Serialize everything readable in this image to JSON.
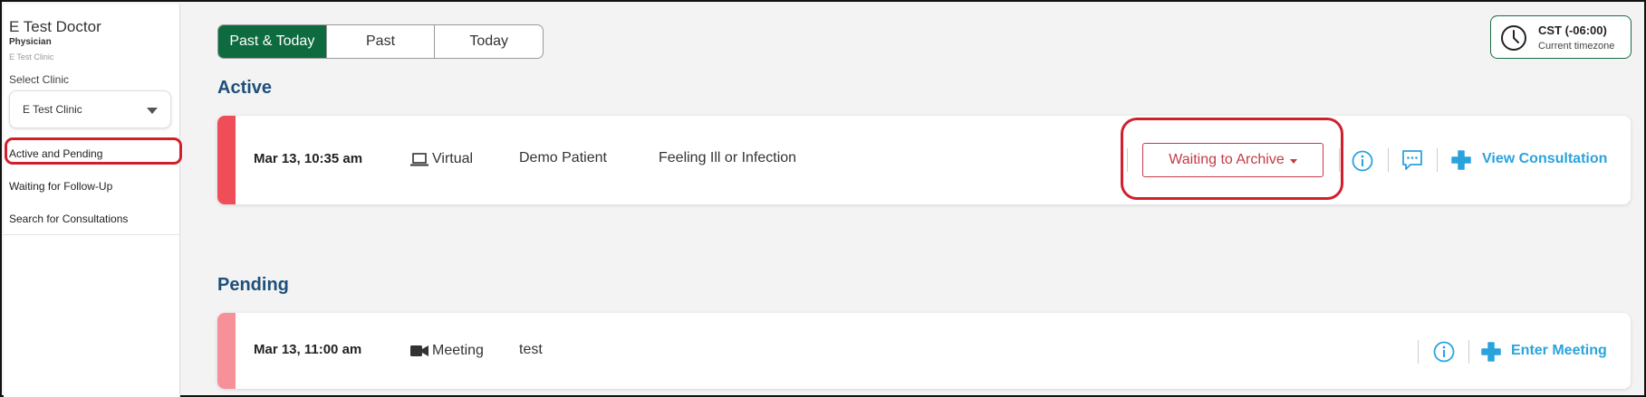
{
  "sidebar": {
    "doctor_name": "E Test Doctor",
    "role": "Physician",
    "clinic": "E Test Clinic",
    "select_clinic_label": "Select Clinic",
    "selected_clinic": "E Test Clinic",
    "nav": [
      {
        "label": "Active and Pending",
        "active": true
      },
      {
        "label": "Waiting for Follow-Up",
        "active": false
      },
      {
        "label": "Search for Consultations",
        "active": false
      }
    ]
  },
  "filter_tabs": [
    {
      "label": "Past & Today",
      "active": true
    },
    {
      "label": "Past",
      "active": false
    },
    {
      "label": "Today",
      "active": false
    }
  ],
  "timezone": {
    "label": "CST (-06:00)",
    "sublabel": "Current timezone",
    "icon": "clock-icon"
  },
  "sections": {
    "active": {
      "title": "Active",
      "consultation": {
        "datetime": "Mar 13, 10:35 am",
        "type": "Virtual",
        "type_icon": "laptop-icon",
        "patient": "Demo Patient",
        "reason": "Feeling Ill or Infection",
        "status": "Waiting to Archive",
        "action": "View Consultation",
        "stripe_color": "#ef4e59"
      }
    },
    "pending": {
      "title": "Pending",
      "consultation": {
        "datetime": "Mar 13, 11:00 am",
        "type": "Meeting",
        "type_icon": "video-camera-icon",
        "patient": "test",
        "action": "Enter Meeting",
        "stripe_color": "#f6919a"
      }
    }
  },
  "colors": {
    "brand_green": "#0d6b3f",
    "heading_blue": "#1d4f7a",
    "link_blue": "#2aa3dd",
    "status_red": "#c43a45",
    "annotation_red": "#d0202e"
  }
}
